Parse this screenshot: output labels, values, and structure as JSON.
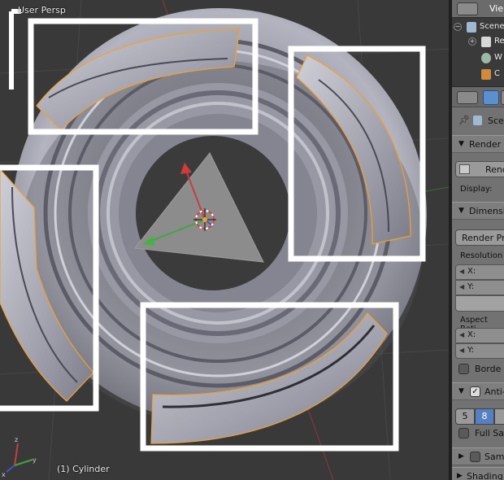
{
  "viewport": {
    "view_label": "User Persp",
    "object_label": "(1) Cylinder",
    "colors": {
      "background": "#393939",
      "grid": "#474747",
      "selection_outline": "#f0a030",
      "annotation_box": "#ffffff",
      "mesh_light": "#c9c9d4",
      "mesh_dark": "#6e6e7a",
      "axis_x": "#c43f3f",
      "axis_y": "#3fa63f",
      "axis_z": "#3f56c4"
    }
  },
  "outliner": {
    "header_label": "Vie",
    "rows": [
      {
        "label": "Scene",
        "icon": "scene-icon",
        "expand": "−"
      },
      {
        "label": "Re",
        "icon": "render-layers-icon",
        "expand": "+"
      },
      {
        "label": "W",
        "icon": "world-icon",
        "expand": ""
      },
      {
        "label": "C",
        "icon": "camera-icon",
        "expand": ""
      }
    ]
  },
  "properties": {
    "breadcrumb": "Scene",
    "render_section": {
      "label": "Render",
      "render_button": "Render",
      "display_label": "Display:"
    },
    "dimensions_section": {
      "label": "Dimensi",
      "presets_button": "Render Pre",
      "resolution_label": "Resolution",
      "res_x_label": "X:",
      "res_y_label": "Y:",
      "aspect_label": "Aspect Rati",
      "aspect_x_label": "X:",
      "aspect_y_label": "Y:",
      "border_label": "Borde"
    },
    "antialiasing_section": {
      "label": "Anti-",
      "checked": true,
      "samples": [
        "5",
        "8"
      ],
      "selected_sample": "8",
      "full_sample_label": "Full Sam"
    },
    "sampled_section": {
      "label": "Sam"
    },
    "shading_section": {
      "label": "Shading"
    }
  }
}
